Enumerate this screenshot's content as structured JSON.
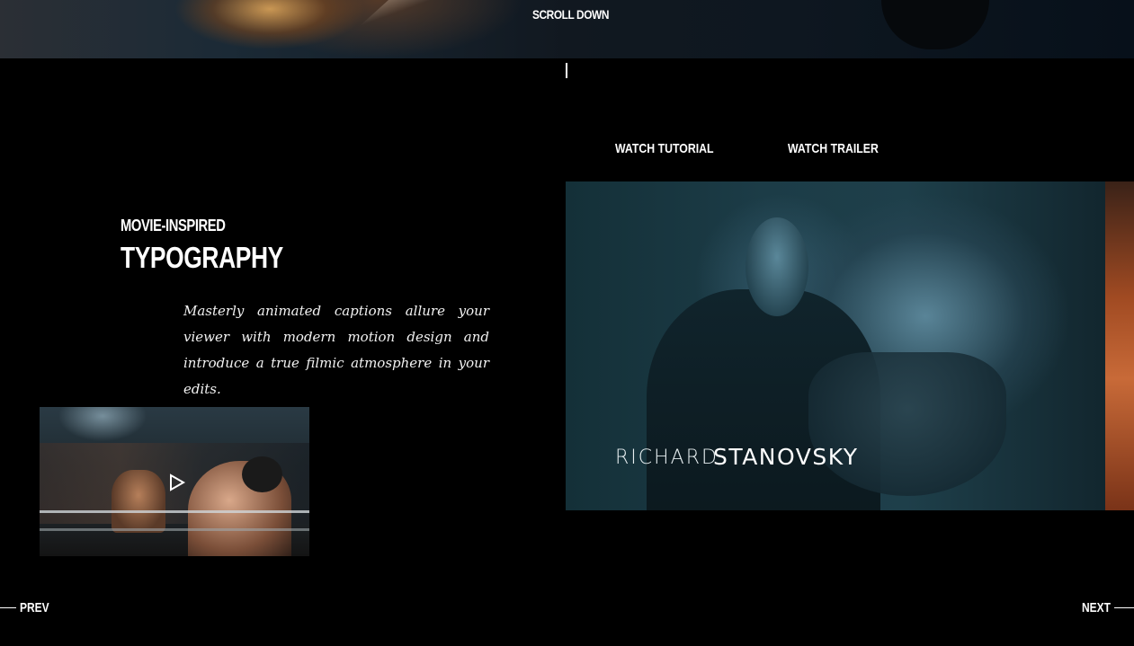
{
  "hero": {
    "scroll_label": "SCROLL DOWN"
  },
  "actions": {
    "tutorial_label": "WATCH TUTORIAL",
    "trailer_label": "WATCH TRAILER"
  },
  "feature": {
    "subtitle": "MOVIE-INSPIRED",
    "title": "TYPOGRAPHY",
    "description": "Masterly animated captions allure your viewer with modern motion design and introduce a true filmic atmosphere in your edits."
  },
  "preview": {
    "name_first": "RICHARD",
    "name_last": "STANOVSKY"
  },
  "video": {
    "icon": "play-icon"
  },
  "nav": {
    "prev_label": "PREV",
    "next_label": "NEXT"
  }
}
